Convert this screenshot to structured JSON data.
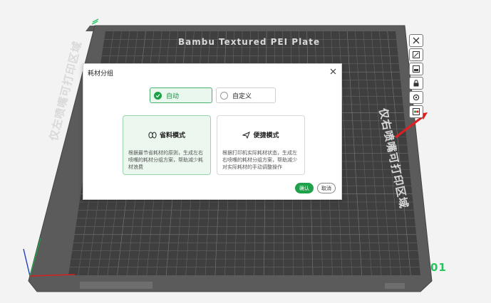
{
  "scene": {
    "plate_title": "Bambu Textured PEI Plate",
    "side_label_left": "仅左喷嘴可打印区域",
    "side_label_right": "仅右喷嘴可打印区域",
    "plate_number": "01"
  },
  "toolbar": {
    "icons": [
      "close-plate-icon",
      "auto-orient-icon",
      "arrange-icon",
      "lock-icon",
      "settings-icon",
      "filament-group-icon"
    ]
  },
  "dialog": {
    "title": "耗材分组",
    "options": [
      {
        "label": "自动",
        "selected": true
      },
      {
        "label": "自定义",
        "selected": false
      }
    ],
    "modes": [
      {
        "title": "省料模式",
        "description": "根据最节省耗材的原则，生成左右喷嘴的耗材分组方案，帮助减少耗材浪费"
      },
      {
        "title": "便捷模式",
        "description": "根据打印机实际耗材状态，生成左右喷嘴的耗材分组方案，帮助减少对实际耗材的手动调整操作"
      }
    ],
    "confirm_label": "确认",
    "cancel_label": "取消"
  },
  "colors": {
    "accent_green": "#1fa04a",
    "plate_dark": "#4a4a4a",
    "grid_line": "#6b6b6b"
  }
}
